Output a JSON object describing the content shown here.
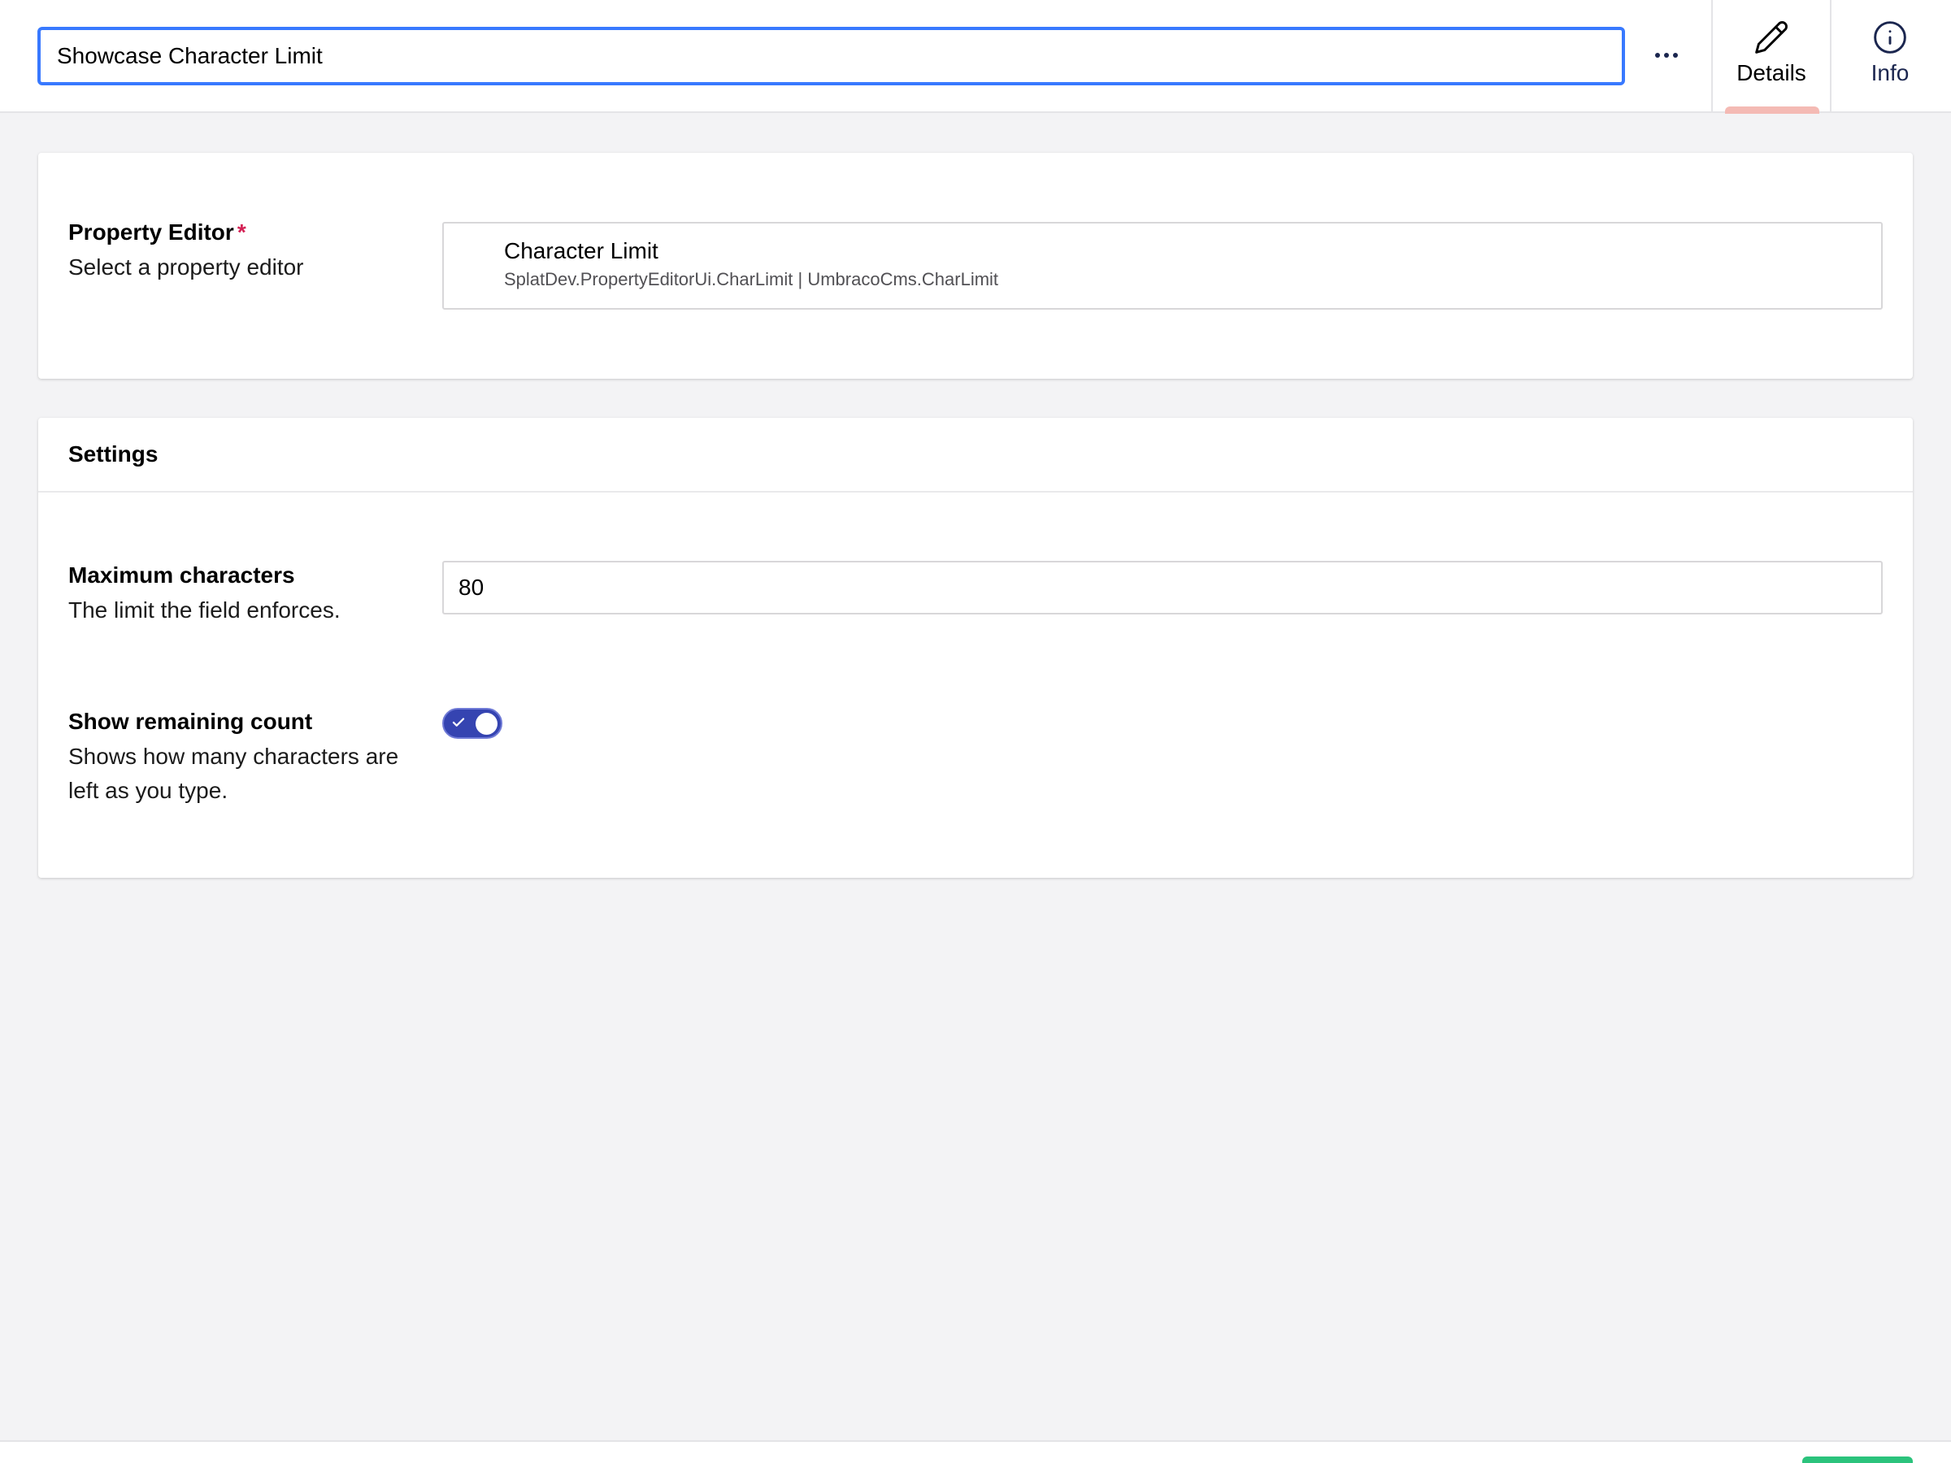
{
  "header": {
    "name_value": "Showcase Character Limit",
    "more_label": "…",
    "tabs": [
      {
        "label": "Details",
        "icon": "pencil-icon",
        "active": true,
        "indicator_color": "#f4bab4"
      },
      {
        "label": "Info",
        "icon": "info-icon",
        "active": false
      }
    ]
  },
  "editor_card": {
    "label": "Property Editor",
    "required_mark": "*",
    "description": "Select a property editor",
    "editor_name": "Character Limit",
    "editor_alias": "SplatDev.PropertyEditorUi.CharLimit | UmbracoCms.CharLimit"
  },
  "settings_card": {
    "title": "Settings",
    "max_chars": {
      "label": "Maximum characters",
      "description": "The limit the field enforces.",
      "value": "80"
    },
    "show_remaining": {
      "label": "Show remaining count",
      "description": "Shows how many characters are left as you type.",
      "enabled": true
    }
  },
  "colors": {
    "focus_border": "#3879ff",
    "toggle_on": "#3544b1",
    "required": "#d42054",
    "save_button": "#2bc37c",
    "text_primary": "#1b264f"
  }
}
